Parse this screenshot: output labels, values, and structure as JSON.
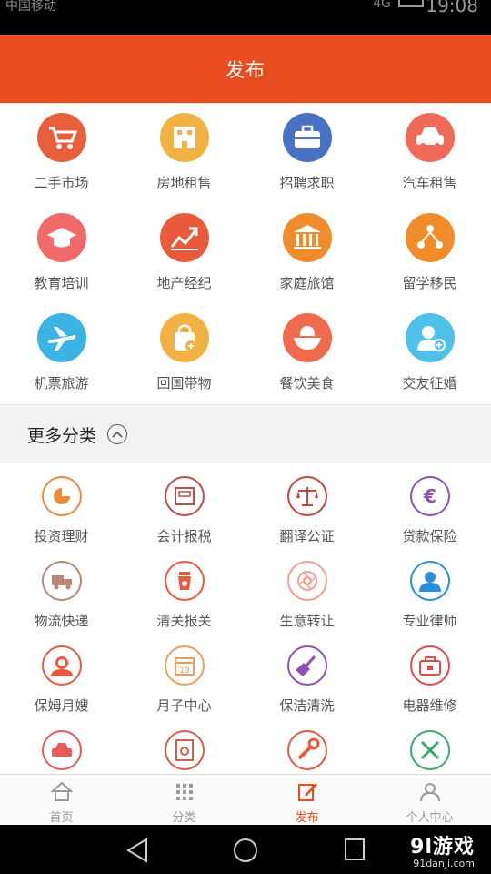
{
  "status_bar": {
    "carrier": "中国移动",
    "network": "4G",
    "time": "19:08"
  },
  "header": {
    "title": "发布"
  },
  "top_categories": [
    {
      "label": "二手市场",
      "icon": "cart-icon",
      "color": "#e85f3b"
    },
    {
      "label": "房地租售",
      "icon": "building-icon",
      "color": "#f2b243"
    },
    {
      "label": "招聘求职",
      "icon": "briefcase-icon",
      "color": "#4a72c4"
    },
    {
      "label": "汽车租售",
      "icon": "car-icon",
      "color": "#ef6a58"
    },
    {
      "label": "教育培训",
      "icon": "graduation-cap-icon",
      "color": "#f06a6a"
    },
    {
      "label": "地产经纪",
      "icon": "trend-chart-icon",
      "color": "#e85a3b"
    },
    {
      "label": "家庭旅馆",
      "icon": "bank-icon",
      "color": "#f18c2c"
    },
    {
      "label": "留学移民",
      "icon": "people-network-icon",
      "color": "#f08c2a"
    },
    {
      "label": "机票旅游",
      "icon": "airplane-icon",
      "color": "#3cb4e3"
    },
    {
      "label": "回国带物",
      "icon": "shopping-bag-icon",
      "color": "#f2b243"
    },
    {
      "label": "餐饮美食",
      "icon": "food-bowl-icon",
      "color": "#f06a4c"
    },
    {
      "label": "交友征婚",
      "icon": "person-add-icon",
      "color": "#4fc0e8"
    }
  ],
  "more_section": {
    "title": "更多分类"
  },
  "sub_categories": [
    {
      "label": "投资理财",
      "icon": "pie-chart-icon",
      "color": "#ef8a3a"
    },
    {
      "label": "会计报税",
      "icon": "calculator-icon",
      "color": "#b3514a"
    },
    {
      "label": "翻译公证",
      "icon": "scales-icon",
      "color": "#c4453a"
    },
    {
      "label": "贷款保险",
      "icon": "euro-icon",
      "color": "#8e4fb8"
    },
    {
      "label": "物流快递",
      "icon": "truck-icon",
      "color": "#b9877a"
    },
    {
      "label": "清关报关",
      "icon": "cup-icon",
      "color": "#e85a3b"
    },
    {
      "label": "生意转让",
      "icon": "aperture-icon",
      "color": "#f2a090"
    },
    {
      "label": "专业律师",
      "icon": "lawyer-icon",
      "color": "#2a8fd4"
    },
    {
      "label": "保姆月嫂",
      "icon": "nanny-icon",
      "color": "#e85a3b"
    },
    {
      "label": "月子中心",
      "icon": "calendar-icon",
      "color": "#e8a060"
    },
    {
      "label": "保洁清洗",
      "icon": "broom-icon",
      "color": "#8e4fb8"
    },
    {
      "label": "电器维修",
      "icon": "toolbox-icon",
      "color": "#e04a4a"
    },
    {
      "label": "",
      "icon": "car-wash-icon",
      "color": "#e85a5a"
    },
    {
      "label": "",
      "icon": "document-search-icon",
      "color": "#d0604a"
    },
    {
      "label": "",
      "icon": "wrench-icon",
      "color": "#e85a3b"
    },
    {
      "label": "",
      "icon": "tools-icon",
      "color": "#3aa86a"
    }
  ],
  "tabbar": [
    {
      "label": "首页",
      "icon": "home-icon",
      "active": false
    },
    {
      "label": "分类",
      "icon": "grid-icon",
      "active": false
    },
    {
      "label": "发布",
      "icon": "edit-icon",
      "active": true
    },
    {
      "label": "个人中心",
      "icon": "user-icon",
      "active": false
    }
  ],
  "watermark": {
    "brand": "9l游戏",
    "domain": "91danji.com"
  }
}
